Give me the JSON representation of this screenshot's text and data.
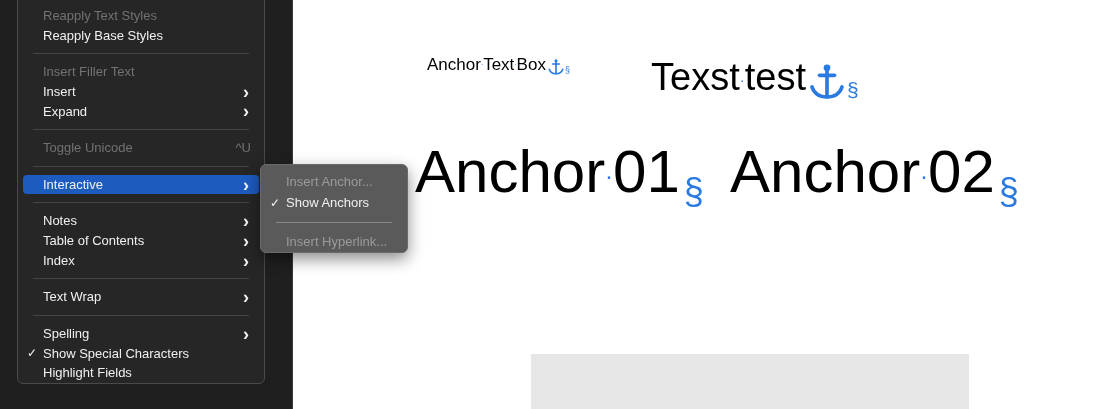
{
  "menu": {
    "items": [
      {
        "kind": "item",
        "label": "Reapply Text Styles",
        "disabled": true,
        "checked": false,
        "selected": false,
        "submenu": false
      },
      {
        "kind": "item",
        "label": "Reapply Base Styles",
        "disabled": false,
        "checked": false,
        "selected": false,
        "submenu": false
      },
      {
        "kind": "separator"
      },
      {
        "kind": "item",
        "label": "Insert Filler Text",
        "disabled": true,
        "checked": false,
        "selected": false,
        "submenu": false
      },
      {
        "kind": "item",
        "label": "Insert",
        "disabled": false,
        "checked": false,
        "selected": false,
        "submenu": true
      },
      {
        "kind": "item",
        "label": "Expand",
        "disabled": false,
        "checked": false,
        "selected": false,
        "submenu": true
      },
      {
        "kind": "separator"
      },
      {
        "kind": "item",
        "label": "Toggle Unicode",
        "shortcut": "^U",
        "disabled": true,
        "checked": false,
        "selected": false,
        "submenu": false
      },
      {
        "kind": "separator"
      },
      {
        "kind": "item",
        "label": "Interactive",
        "disabled": false,
        "checked": false,
        "selected": true,
        "submenu": true
      },
      {
        "kind": "separator"
      },
      {
        "kind": "item",
        "label": "Notes",
        "disabled": false,
        "checked": false,
        "selected": false,
        "submenu": true
      },
      {
        "kind": "item",
        "label": "Table of Contents",
        "disabled": false,
        "checked": false,
        "selected": false,
        "submenu": true
      },
      {
        "kind": "item",
        "label": "Index",
        "disabled": false,
        "checked": false,
        "selected": false,
        "submenu": true
      },
      {
        "kind": "separator"
      },
      {
        "kind": "item",
        "label": "Text Wrap",
        "disabled": false,
        "checked": false,
        "selected": false,
        "submenu": true
      },
      {
        "kind": "separator"
      },
      {
        "kind": "item",
        "label": "Spelling",
        "disabled": false,
        "checked": false,
        "selected": false,
        "submenu": true
      },
      {
        "kind": "item",
        "label": "Show Special Characters",
        "disabled": false,
        "checked": true,
        "selected": false,
        "submenu": false
      },
      {
        "kind": "item",
        "label": "Highlight Fields",
        "disabled": false,
        "checked": false,
        "selected": false,
        "submenu": false
      }
    ]
  },
  "submenu": {
    "items": [
      {
        "kind": "item",
        "label": "Insert Anchor...",
        "disabled": true,
        "checked": false
      },
      {
        "kind": "item",
        "label": "Show Anchors",
        "disabled": false,
        "checked": true
      },
      {
        "kind": "separator"
      },
      {
        "kind": "item",
        "label": "Insert Hyperlink...",
        "disabled": true,
        "checked": false
      }
    ]
  },
  "check_mark": "✓",
  "arrow": "›",
  "document": {
    "texts": [
      {
        "kind": "anchor",
        "text": "Anchor·Text·Box",
        "marker": "§"
      },
      {
        "kind": "anchor",
        "text": "Texst·test",
        "marker": "§"
      },
      {
        "kind": "paragraph",
        "text": "Anchor·01",
        "marker": "§"
      },
      {
        "kind": "paragraph",
        "text": "Anchor·02",
        "marker": "§"
      }
    ]
  }
}
